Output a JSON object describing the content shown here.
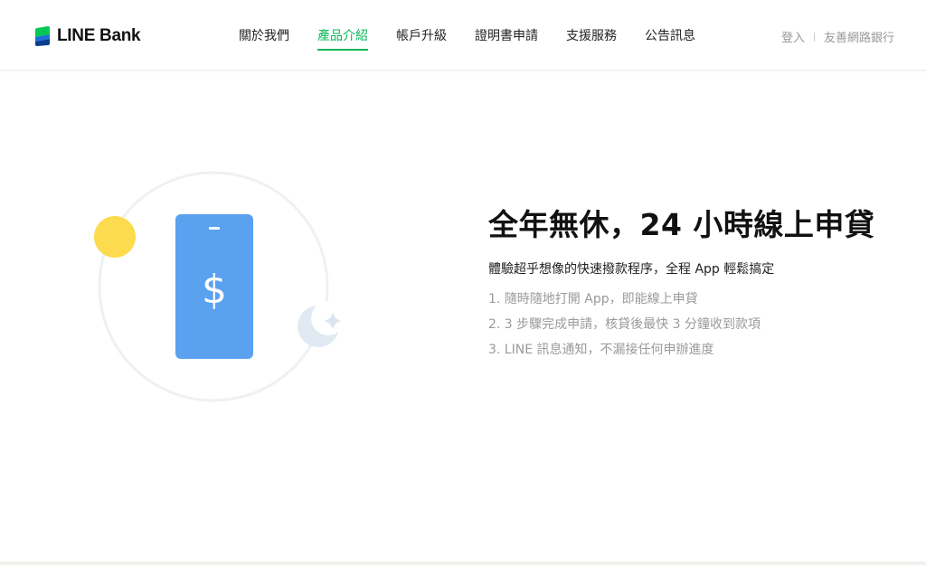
{
  "brand": {
    "name": "LINE Bank",
    "accent_color": "#06b755"
  },
  "nav": {
    "items": [
      {
        "label": "關於我們"
      },
      {
        "label": "產品介紹",
        "active": true
      },
      {
        "label": "帳戶升級"
      },
      {
        "label": "證明書申請"
      },
      {
        "label": "支援服務"
      },
      {
        "label": "公告訊息"
      }
    ]
  },
  "utility": {
    "login": "登入",
    "friendly_banking": "友善網路銀行"
  },
  "illustration": {
    "phone_color": "#5aa1f0",
    "sun_color": "#fddb4f",
    "moon_color": "#e1eaf3",
    "icons": [
      "phone-icon",
      "dollar-icon",
      "sun-icon",
      "moon-icon",
      "sparkle-icon"
    ]
  },
  "hero": {
    "title": "全年無休，24 小時線上申貸",
    "subtitle": "體驗超乎想像的快速撥款程序，全程 App 輕鬆搞定",
    "steps": [
      "1. 隨時隨地打開 App，即能線上申貸",
      "2. 3 步驟完成申請，核貸後最快 3 分鐘收到款項",
      "3. LINE 訊息通知，不漏接任何申辦進度"
    ]
  }
}
